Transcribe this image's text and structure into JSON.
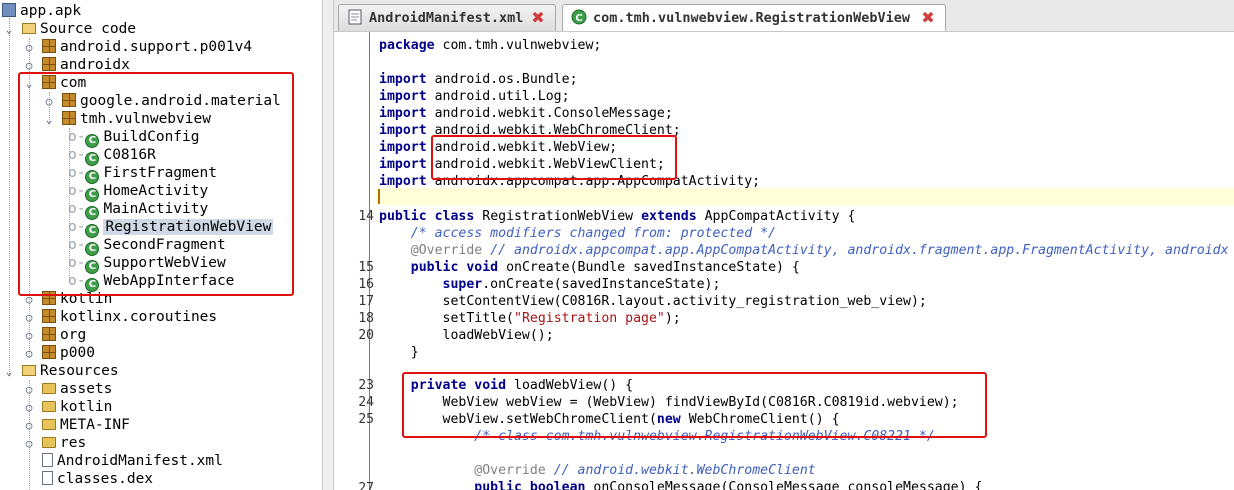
{
  "tree": {
    "root": "app.apk",
    "source_code": "Source code",
    "packages": {
      "android_support": "android.support.p001v4",
      "androidx": "androidx",
      "com": "com",
      "google_material": "google.android.material",
      "tmh": "tmh.vulnwebview",
      "kotlin": "kotlin",
      "kotlinx": "kotlinx.coroutines",
      "org": "org",
      "p000": "p000"
    },
    "classes": [
      "BuildConfig",
      "C0816R",
      "FirstFragment",
      "HomeActivity",
      "MainActivity",
      "RegistrationWebView",
      "SecondFragment",
      "SupportWebView",
      "WebAppInterface"
    ],
    "resources": "Resources",
    "resource_items": [
      "assets",
      "kotlin",
      "META-INF",
      "res",
      "AndroidManifest.xml",
      "classes.dex"
    ]
  },
  "tabs": [
    {
      "label": "AndroidManifest.xml",
      "active": false
    },
    {
      "label": "com.tmh.vulnwebview.RegistrationWebView",
      "active": true
    }
  ],
  "editor": {
    "line_numbers": {
      "l14": "14",
      "l15": "15",
      "l16": "16",
      "l17": "17",
      "l18": "18",
      "l20": "20",
      "l23": "23",
      "l24": "24",
      "l25": "25",
      "l27": "27"
    },
    "package_decl": "com.tmh.vulnwebview;",
    "imports": [
      "android.os.Bundle;",
      "android.util.Log;",
      "android.webkit.ConsoleMessage;",
      "android.webkit.WebChromeClient;",
      "android.webkit.WebView;",
      "android.webkit.WebViewClient;",
      "androidx.appcompat.app.AppCompatActivity;"
    ],
    "class_name": "RegistrationWebView",
    "superclass": "AppCompatActivity {",
    "comment_modifiers": "/* access modifiers changed from: protected */",
    "override_comment": "// androidx.appcompat.app.AppCompatActivity, androidx.fragment.app.FragmentActivity, androidx",
    "oncreate_sig": "onCreate(Bundle savedInstanceState) {",
    "super_call": ".onCreate(savedInstanceState);",
    "set_content": "setContentView(C0816R.layout.activity_registration_web_view);",
    "set_title_pre": "setTitle(",
    "set_title_str": "\"Registration page\"",
    "set_title_post": ");",
    "load_call": "loadWebView();",
    "close_brace": "}",
    "loadwebview_sig": "loadWebView() {",
    "webview_line": "WebView webView = (WebView) findViewById(C0816R.C0819id.webview);",
    "chrome_pre": "webView.setWebChromeClient(",
    "chrome_post": "WebChromeClient() {",
    "class_comment": "/* class com.tmh.vulnwebview.RegistrationWebView.C08221 */",
    "override2_comment": "// android.webkit.WebChromeClient",
    "console_sig": "onConsoleMessage(ConsoleMessage consoleMessage) {"
  },
  "keywords": {
    "package": "package",
    "import": "import",
    "public": "public",
    "class": "class",
    "extends": "extends",
    "void": "void",
    "super": "super",
    "private": "private",
    "new": "new",
    "boolean": "boolean",
    "override": "@Override"
  },
  "colors": {
    "accent_highlight": "#e01010",
    "keyword": "#00008b",
    "comment": "#3f5fbf"
  },
  "icons": {
    "package": "package-icon",
    "class": "class-icon",
    "folder": "folder-icon",
    "close": "close-icon"
  }
}
